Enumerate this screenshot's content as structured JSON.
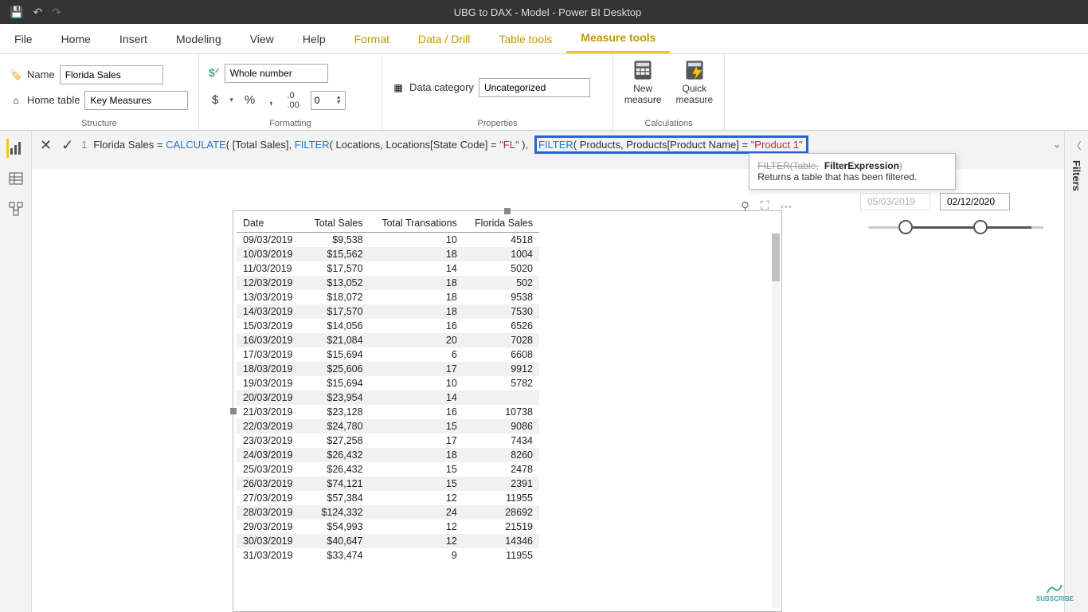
{
  "window_title": "UBG to DAX - Model - Power BI Desktop",
  "menu": {
    "file": "File",
    "home": "Home",
    "insert": "Insert",
    "modeling": "Modeling",
    "view": "View",
    "help": "Help",
    "format": "Format",
    "datadrill": "Data / Drill",
    "tabletools": "Table tools",
    "measuretools": "Measure tools"
  },
  "ribbon": {
    "structure": {
      "label": "Structure",
      "name_lbl": "Name",
      "name_val": "Florida Sales",
      "home_lbl": "Home table",
      "home_val": "Key Measures"
    },
    "formatting": {
      "label": "Formatting",
      "format_val": "Whole number",
      "currency": "$",
      "percent": "%",
      "comma": ",",
      "dec_inc_icon": ".00→.0",
      "decimals": "0"
    },
    "properties": {
      "label": "Properties",
      "cat_lbl": "Data category",
      "cat_val": "Uncategorized"
    },
    "calculations": {
      "label": "Calculations",
      "new_measure": "New\nmeasure",
      "quick_measure": "Quick\nmeasure"
    }
  },
  "formula": {
    "line_no": "1",
    "measure": "Florida Sales",
    "eq": " = ",
    "calc": "CALCULATE",
    "open": "( ",
    "totalsales": "[Total Sales]",
    "sep": ", ",
    "filter1": "FILTER",
    "f1args": "( Locations, Locations[State Code] = ",
    "fl": "\"FL\"",
    "f1close": " ),",
    "filter2": "FILTER",
    "f2args": "( Products, Products[Product Name] = ",
    "prod1": "\"Product 1\"",
    "tooltip_sig": "FILTER(Table, FilterExpression)",
    "tooltip_desc": "Returns a table that has been filtered."
  },
  "slicer": {
    "start": "05/03/2019",
    "end": "02/12/2020"
  },
  "table": {
    "headers": {
      "date": "Date",
      "total_sales": "Total Sales",
      "total_trans": "Total Transations",
      "fl": "Florida Sales"
    },
    "rows": [
      {
        "d": "09/03/2019",
        "s": "$9,538",
        "t": "10",
        "f": "4518"
      },
      {
        "d": "10/03/2019",
        "s": "$15,562",
        "t": "18",
        "f": "1004"
      },
      {
        "d": "11/03/2019",
        "s": "$17,570",
        "t": "14",
        "f": "5020"
      },
      {
        "d": "12/03/2019",
        "s": "$13,052",
        "t": "18",
        "f": "502"
      },
      {
        "d": "13/03/2019",
        "s": "$18,072",
        "t": "18",
        "f": "9538"
      },
      {
        "d": "14/03/2019",
        "s": "$17,570",
        "t": "18",
        "f": "7530"
      },
      {
        "d": "15/03/2019",
        "s": "$14,056",
        "t": "16",
        "f": "6526"
      },
      {
        "d": "16/03/2019",
        "s": "$21,084",
        "t": "20",
        "f": "7028"
      },
      {
        "d": "17/03/2019",
        "s": "$15,694",
        "t": "6",
        "f": "6608"
      },
      {
        "d": "18/03/2019",
        "s": "$25,606",
        "t": "17",
        "f": "9912"
      },
      {
        "d": "19/03/2019",
        "s": "$15,694",
        "t": "10",
        "f": "5782"
      },
      {
        "d": "20/03/2019",
        "s": "$23,954",
        "t": "14",
        "f": ""
      },
      {
        "d": "21/03/2019",
        "s": "$23,128",
        "t": "16",
        "f": "10738"
      },
      {
        "d": "22/03/2019",
        "s": "$24,780",
        "t": "15",
        "f": "9086"
      },
      {
        "d": "23/03/2019",
        "s": "$27,258",
        "t": "17",
        "f": "7434"
      },
      {
        "d": "24/03/2019",
        "s": "$26,432",
        "t": "18",
        "f": "8260"
      },
      {
        "d": "25/03/2019",
        "s": "$26,432",
        "t": "15",
        "f": "2478"
      },
      {
        "d": "26/03/2019",
        "s": "$74,121",
        "t": "15",
        "f": "2391"
      },
      {
        "d": "27/03/2019",
        "s": "$57,384",
        "t": "12",
        "f": "11955"
      },
      {
        "d": "28/03/2019",
        "s": "$124,332",
        "t": "24",
        "f": "28692"
      },
      {
        "d": "29/03/2019",
        "s": "$54,993",
        "t": "12",
        "f": "21519"
      },
      {
        "d": "30/03/2019",
        "s": "$40,647",
        "t": "12",
        "f": "14346"
      },
      {
        "d": "31/03/2019",
        "s": "$33,474",
        "t": "9",
        "f": "11955"
      }
    ]
  },
  "filters_label": "Filters",
  "subscribe": "SUBSCRIBE"
}
